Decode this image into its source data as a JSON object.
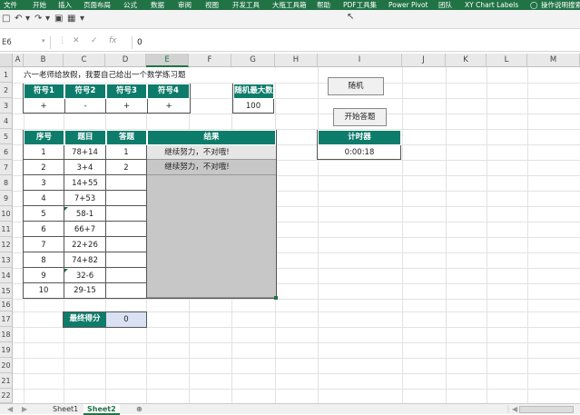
{
  "ribbon": {
    "tabs": [
      "文件",
      "开始",
      "插入",
      "页面布局",
      "公式",
      "数据",
      "审阅",
      "视图",
      "开发工具",
      "大瓶工具箱",
      "帮助",
      "PDF工具集",
      "Power Pivot",
      "团队",
      "XY Chart Labels"
    ],
    "tell_me": "操作说明搜索"
  },
  "formula_bar": {
    "name_box": "E6",
    "value": "0"
  },
  "columns": [
    "A",
    "B",
    "C",
    "D",
    "E",
    "F",
    "G",
    "H",
    "I",
    "J",
    "K",
    "L",
    "M"
  ],
  "rows": [
    "1",
    "2",
    "3",
    "4",
    "5",
    "6",
    "7",
    "8",
    "9",
    "10",
    "11",
    "12",
    "13",
    "14",
    "15",
    "16",
    "17",
    "18",
    "19",
    "20",
    "21",
    "22"
  ],
  "sheet": {
    "title": "六一老师给放假，我要自己给出一个数学练习题",
    "symbols": {
      "headers": [
        "符号1",
        "符号2",
        "符号3",
        "符号4"
      ],
      "values": [
        "+",
        "-",
        "+",
        "+"
      ]
    },
    "random_max": {
      "header": "随机最大数",
      "value": "100"
    },
    "buttons": {
      "random": "随机",
      "start": "开始答题"
    },
    "timer": {
      "header": "计时器",
      "value": "0:00:18"
    },
    "quiz": {
      "headers": [
        "序号",
        "题目",
        "答题",
        "结果"
      ],
      "rows": [
        {
          "no": "1",
          "q": "78+14",
          "a": "1",
          "r": "继续努力，不对哦!"
        },
        {
          "no": "2",
          "q": "3+4",
          "a": "2",
          "r": "继续努力，不对哦!"
        },
        {
          "no": "3",
          "q": "14+55",
          "a": "",
          "r": ""
        },
        {
          "no": "4",
          "q": "7+53",
          "a": "",
          "r": ""
        },
        {
          "no": "5",
          "q": "58-1",
          "a": "",
          "r": ""
        },
        {
          "no": "6",
          "q": "66+7",
          "a": "",
          "r": ""
        },
        {
          "no": "7",
          "q": "22+26",
          "a": "",
          "r": ""
        },
        {
          "no": "8",
          "q": "74+82",
          "a": "",
          "r": ""
        },
        {
          "no": "9",
          "q": "32-6",
          "a": "",
          "r": ""
        },
        {
          "no": "10",
          "q": "29-15",
          "a": "",
          "r": ""
        }
      ]
    },
    "final_score": {
      "label": "最终得分",
      "value": "0"
    }
  },
  "sheet_tabs": [
    "Sheet1",
    "Sheet2"
  ],
  "accent": "#217346",
  "table_header_color": "#0e7c6b"
}
